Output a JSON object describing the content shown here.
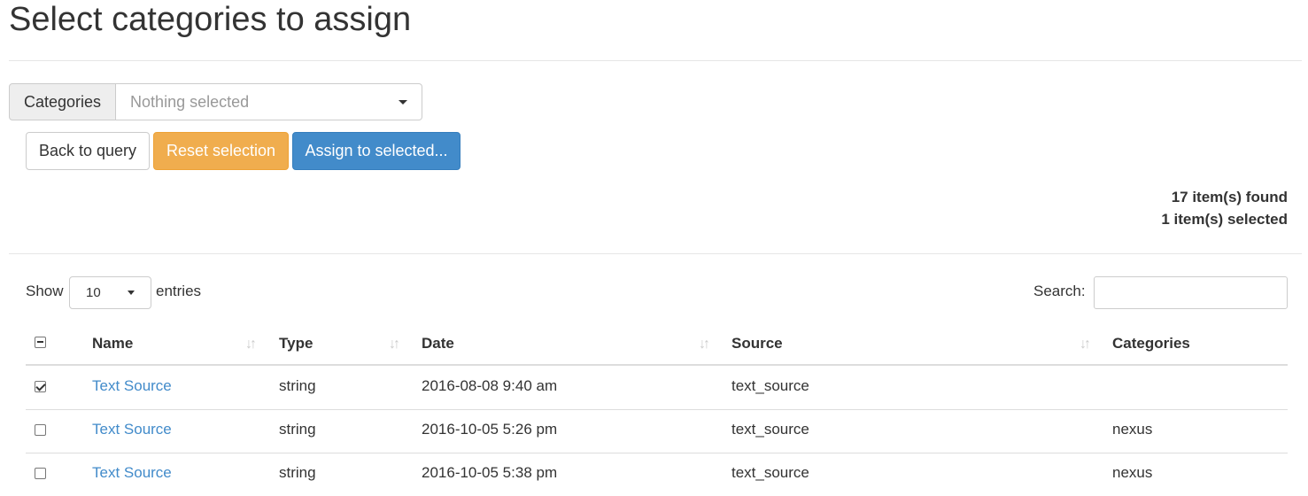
{
  "page": {
    "title": "Select categories to assign"
  },
  "categories_filter": {
    "label": "Categories",
    "placeholder": "Nothing selected"
  },
  "buttons": {
    "back": "Back to query",
    "reset": "Reset selection",
    "assign": "Assign to selected..."
  },
  "status": {
    "found": "17 item(s) found",
    "selected": "1 item(s) selected"
  },
  "table_controls": {
    "show_label": "Show",
    "entries_value": "10",
    "entries_label": "entries",
    "search_label": "Search:",
    "search_value": ""
  },
  "table": {
    "headers": {
      "name": "Name",
      "type": "Type",
      "date": "Date",
      "source": "Source",
      "categories": "Categories"
    },
    "rows": [
      {
        "checked": true,
        "name": "Text Source",
        "type": "string",
        "date": "2016-08-08 9:40 am",
        "source": "text_source",
        "categories": ""
      },
      {
        "checked": false,
        "name": "Text Source",
        "type": "string",
        "date": "2016-10-05 5:26 pm",
        "source": "text_source",
        "categories": "nexus"
      },
      {
        "checked": false,
        "name": "Text Source",
        "type": "string",
        "date": "2016-10-05 5:38 pm",
        "source": "text_source",
        "categories": "nexus"
      }
    ]
  },
  "colors": {
    "link": "#428bca",
    "warning": "#f0ad4e",
    "primary": "#428bca"
  }
}
